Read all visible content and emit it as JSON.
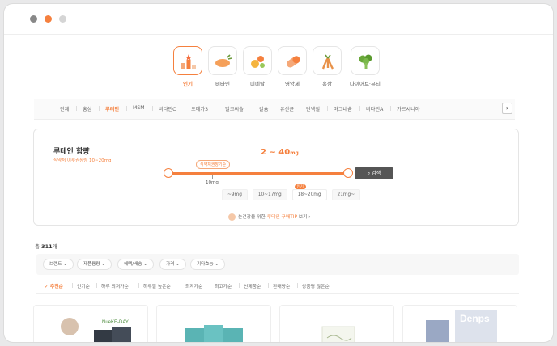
{
  "categories": [
    {
      "label": "인기",
      "icon": "trophy-icon",
      "active": true
    },
    {
      "label": "비타민",
      "icon": "carrot-icon",
      "active": false
    },
    {
      "label": "미네랄",
      "icon": "mineral-icon",
      "active": false
    },
    {
      "label": "영양제",
      "icon": "capsule-icon",
      "active": false
    },
    {
      "label": "홍삼",
      "icon": "ginseng-icon",
      "active": false
    },
    {
      "label": "다이어트·뷰티",
      "icon": "broccoli-icon",
      "active": false
    }
  ],
  "subtabs": [
    "전체",
    "홍삼",
    "루테인",
    "MSM",
    "비타민C",
    "오메가3",
    "밀크씨슬",
    "칼슘",
    "유산균",
    "단백질",
    "마그네슘",
    "비타민A",
    "가르시니아"
  ],
  "active_subtab": "루테인",
  "panel": {
    "title": "루테인 함량",
    "subtitle": "식약처 이루권장량 10~20mg",
    "range_value": "2 ~ 40",
    "range_unit": "mg",
    "recommend_badge": "식약처권장기준",
    "tick_label": "10mg",
    "search_label": "검색",
    "chips": [
      {
        "label": "~9mg",
        "hot": ""
      },
      {
        "label": "10~17mg",
        "hot": ""
      },
      {
        "label": "18~20mg",
        "hot": "인기"
      },
      {
        "label": "21mg~",
        "hot": ""
      }
    ],
    "tip_prefix": "눈건강을 위한 ",
    "tip_highlight": "루테인 구매TIP",
    "tip_suffix": " 보기 ›"
  },
  "count_prefix": "총 ",
  "count": "311",
  "count_suffix": "개",
  "filters": [
    "브랜드",
    "제품용량",
    "혜택/배송",
    "가격",
    "기타효능"
  ],
  "sorts": [
    "추천순",
    "인기순",
    "하루 최저가순",
    "하루필 높은순",
    "최저가순",
    "최고가순",
    "신제품순",
    "판매량순",
    "상품평 많은순"
  ],
  "cards": [
    {
      "text": "NueKE-DAY"
    },
    {
      "text": ""
    },
    {
      "text": ""
    },
    {
      "text": "Denps"
    }
  ],
  "colors": {
    "accent": "#f5803e",
    "window_red": "#888888",
    "window_orange": "#f5803e",
    "window_gray": "#d5d5d5"
  }
}
